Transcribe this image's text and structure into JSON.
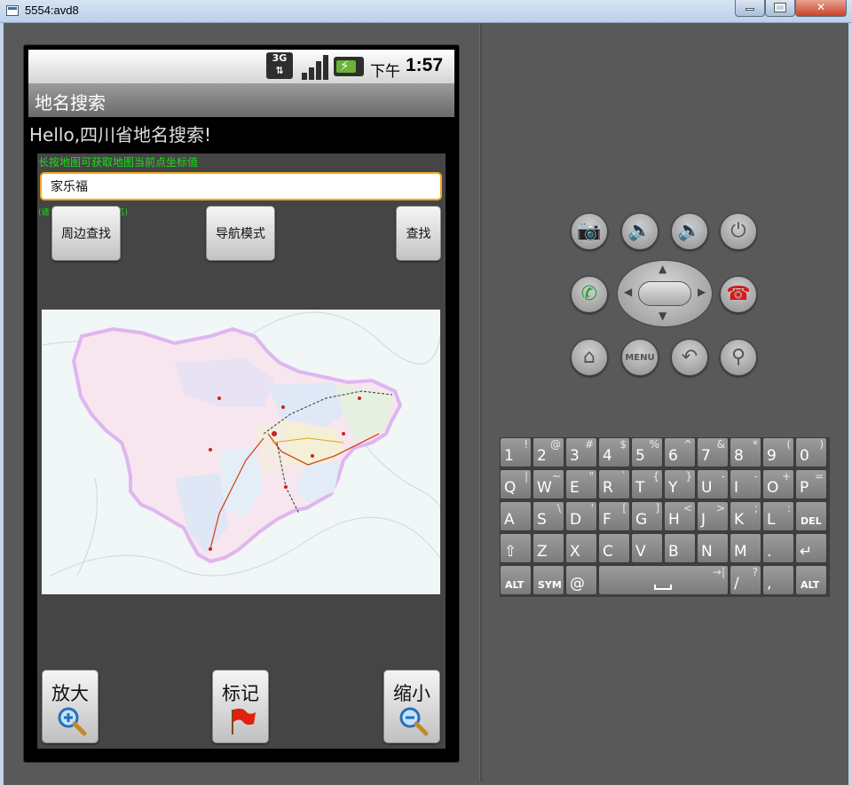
{
  "window": {
    "title": "5554:avd8"
  },
  "status_bar": {
    "network": "3G",
    "ampm": "下午",
    "time": "1:57"
  },
  "app": {
    "title": "地名搜索",
    "hello": "Hello,四川省地名搜索!",
    "hint": "长按地图可获取地图当前点坐标值",
    "search": {
      "value": "家乐福"
    },
    "input_tip_left": "(请",
    "input_tip_right": "名)",
    "buttons": {
      "nearby": "周边查找",
      "navigate": "导航模式",
      "find": "查找"
    },
    "bottom_buttons": {
      "zoom_in": "放大",
      "mark": "标记",
      "zoom_out": "缩小"
    }
  },
  "hardware": {
    "menu": "MENU"
  },
  "keyboard": {
    "rows": [
      [
        [
          "1",
          "!"
        ],
        [
          "2",
          "@"
        ],
        [
          "3",
          "#"
        ],
        [
          "4",
          "$"
        ],
        [
          "5",
          "%"
        ],
        [
          "6",
          "^"
        ],
        [
          "7",
          "&"
        ],
        [
          "8",
          "*"
        ],
        [
          "9",
          "("
        ],
        [
          "0",
          ")"
        ]
      ],
      [
        [
          "Q",
          "|"
        ],
        [
          "W",
          "~"
        ],
        [
          "E",
          "\""
        ],
        [
          "R",
          "`"
        ],
        [
          "T",
          "{"
        ],
        [
          "Y",
          "}"
        ],
        [
          "U",
          "-"
        ],
        [
          "I",
          "-"
        ],
        [
          "O",
          "+"
        ],
        [
          "P",
          "="
        ]
      ],
      [
        [
          "A",
          ""
        ],
        [
          "S",
          "\\"
        ],
        [
          "D",
          "'"
        ],
        [
          "F",
          "["
        ],
        [
          "G",
          "]"
        ],
        [
          "H",
          "<"
        ],
        [
          "J",
          ">"
        ],
        [
          "K",
          ";"
        ],
        [
          "L",
          ":"
        ],
        [
          "DEL",
          ""
        ]
      ],
      [
        [
          "⇧",
          ""
        ],
        [
          "Z",
          ""
        ],
        [
          "X",
          ""
        ],
        [
          "C",
          ""
        ],
        [
          "V",
          ""
        ],
        [
          "B",
          ""
        ],
        [
          "N",
          ""
        ],
        [
          "M",
          ""
        ],
        [
          ".",
          ""
        ],
        [
          "↵",
          ""
        ]
      ],
      [
        [
          "ALT",
          ""
        ],
        [
          "SYM",
          ""
        ],
        [
          "@",
          ""
        ],
        [
          "",
          ""
        ],
        [
          "/",
          "?"
        ],
        [
          ",",
          ""
        ],
        [
          "ALT",
          ""
        ]
      ]
    ]
  },
  "colors": {
    "accent_hint": "#19e012",
    "input_border": "#f2a81c",
    "province_fill": "#f7e6ee"
  }
}
